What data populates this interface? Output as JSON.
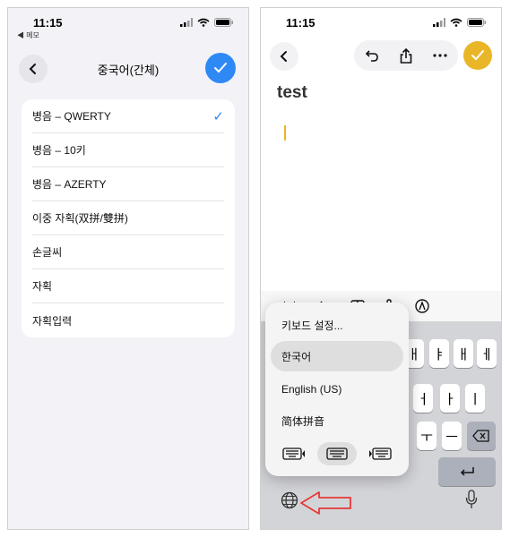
{
  "left": {
    "status": {
      "time": "11:15",
      "back_app": "◀ 메모"
    },
    "title": "중국어(간체)",
    "layouts": [
      {
        "label": "병음 – QWERTY",
        "selected": true
      },
      {
        "label": "병음 – 10키",
        "selected": false
      },
      {
        "label": "병음 – AZERTY",
        "selected": false
      },
      {
        "label": "이중 자획(双拼/雙拼)",
        "selected": false
      },
      {
        "label": "손글씨",
        "selected": false
      },
      {
        "label": "자획",
        "selected": false
      },
      {
        "label": "자획입력",
        "selected": false
      }
    ],
    "check_glyph": "✓"
  },
  "right": {
    "status": {
      "time": "11:15"
    },
    "note_title": "test",
    "format_bar": {
      "aa_label": "가가"
    },
    "keyboard": {
      "vowel_keys_row1": [
        "ㅐ",
        "ㅔ"
      ],
      "vowel_keys_row2": [
        "ㅓ",
        "ㅏ",
        "ㅣ"
      ],
      "vowel_keys_row3": [
        "ㅜ",
        "ㅡ"
      ]
    },
    "input_menu": {
      "items": [
        {
          "label": "키보드 설정...",
          "selected": false
        },
        {
          "label": "한국어",
          "selected": true
        },
        {
          "label": "English (US)",
          "selected": false
        },
        {
          "label": "简体拼音",
          "selected": false
        }
      ]
    }
  },
  "colors": {
    "accent_blue": "#2f89f5",
    "accent_yellow": "#e9b628",
    "annotation_red": "#e53935"
  }
}
